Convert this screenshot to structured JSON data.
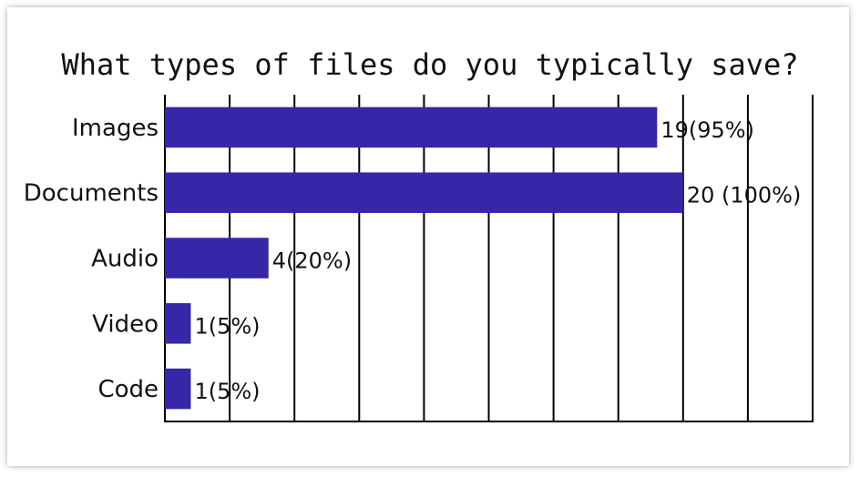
{
  "chart_data": {
    "type": "bar",
    "orientation": "horizontal",
    "title": "What types of files do you typically save?",
    "categories": [
      "Images",
      "Documents",
      "Audio",
      "Video",
      "Code"
    ],
    "values": [
      19,
      20,
      4,
      1,
      1
    ],
    "data_labels": [
      "19(95%)",
      "20 (100%)",
      "4(20%)",
      "1(5%)",
      "1(5%)"
    ],
    "xlim": [
      0,
      25
    ],
    "grid": true,
    "gridline_step": 2.5,
    "bar_color": "#3527a8",
    "legend": "none"
  }
}
